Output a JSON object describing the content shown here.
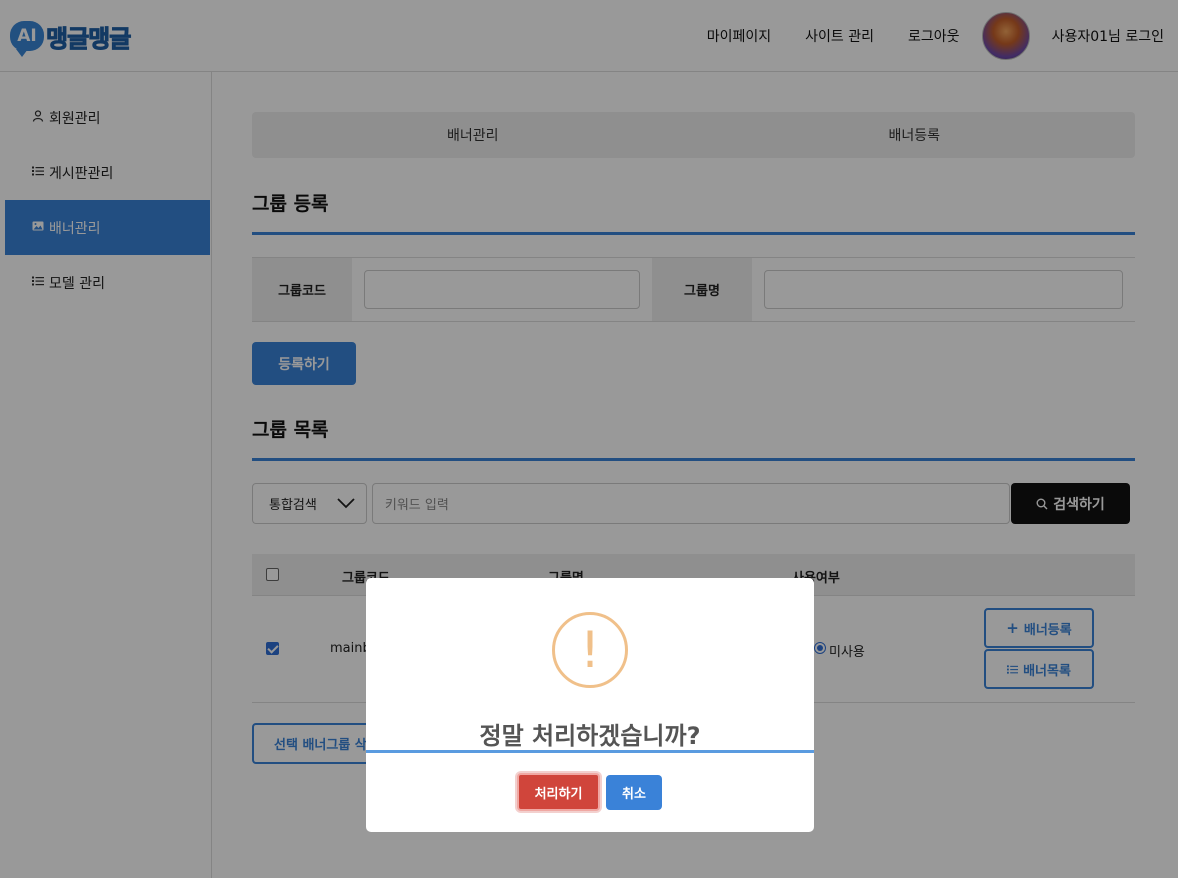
{
  "header": {
    "logo_badge": "AI",
    "logo_text": "맹글맹글",
    "nav": [
      "마이페이지",
      "사이트 관리",
      "로그아웃"
    ],
    "user_label": "사용자01님 로그인"
  },
  "sidebar": {
    "items": [
      {
        "label": "회원관리",
        "icon": "person-icon"
      },
      {
        "label": "게시판관리",
        "icon": "list-icon"
      },
      {
        "label": "배너관리",
        "icon": "image-icon",
        "active": true
      },
      {
        "label": "모델 관리",
        "icon": "list-icon"
      }
    ]
  },
  "tabs": [
    "배너관리",
    "배너등록"
  ],
  "group_register": {
    "title": "그룹 등록",
    "code_label": "그룹코드",
    "name_label": "그룹명",
    "code_value": "",
    "name_value": "",
    "submit_label": "등록하기"
  },
  "group_list": {
    "title": "그룹 목록",
    "search_select": "통합검색",
    "keyword_placeholder": "키워드 입력",
    "search_button": "검색하기",
    "columns": [
      "그룹코드",
      "그룹명",
      "사용여부"
    ],
    "rows": [
      {
        "code": "mainb",
        "usage": "미사용",
        "checked": true
      }
    ],
    "add_banner_button": "배너등록",
    "banner_list_button": "배너목록",
    "delete_button": "선택 배너그룹 삭"
  },
  "modal": {
    "icon": "!",
    "title": "정말 처리하겠습니까?",
    "confirm_label": "처리하기",
    "cancel_label": "취소"
  },
  "colors": {
    "accent": "#3a82d8",
    "danger": "#d0453b",
    "warning": "#f0c08a"
  }
}
